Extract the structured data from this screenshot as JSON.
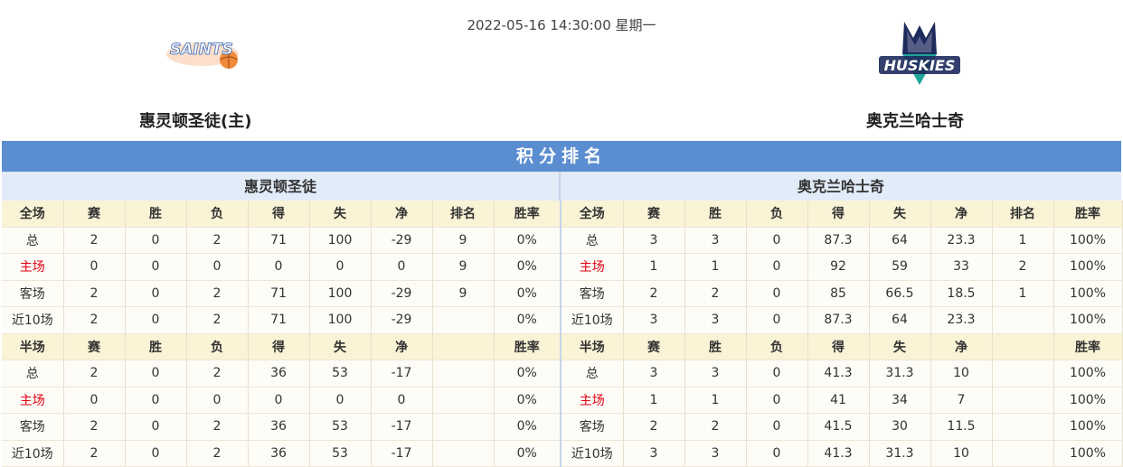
{
  "match": {
    "datetime": "2022-05-16 14:30:00 星期一",
    "home_team": "惠灵顿圣徒(主)",
    "away_team": "奥克兰哈士奇",
    "home_logo_text": "SAINTS",
    "away_logo_text": "HUSKIES"
  },
  "standings": {
    "title": "积分排名",
    "home_label": "惠灵顿圣徒",
    "away_label": "奥克兰哈士奇",
    "full_header": [
      "全场",
      "赛",
      "胜",
      "负",
      "得",
      "失",
      "净",
      "排名",
      "胜率"
    ],
    "half_header": [
      "半场",
      "赛",
      "胜",
      "负",
      "得",
      "失",
      "净",
      "",
      "胜率"
    ],
    "home_full": [
      [
        "总",
        "2",
        "0",
        "2",
        "71",
        "100",
        "-29",
        "9",
        "0%"
      ],
      [
        "主场",
        "0",
        "0",
        "0",
        "0",
        "0",
        "0",
        "9",
        "0%"
      ],
      [
        "客场",
        "2",
        "0",
        "2",
        "71",
        "100",
        "-29",
        "9",
        "0%"
      ],
      [
        "近10场",
        "2",
        "0",
        "2",
        "71",
        "100",
        "-29",
        "",
        "0%"
      ]
    ],
    "home_half": [
      [
        "总",
        "2",
        "0",
        "2",
        "36",
        "53",
        "-17",
        "",
        "0%"
      ],
      [
        "主场",
        "0",
        "0",
        "0",
        "0",
        "0",
        "0",
        "",
        "0%"
      ],
      [
        "客场",
        "2",
        "0",
        "2",
        "36",
        "53",
        "-17",
        "",
        "0%"
      ],
      [
        "近10场",
        "2",
        "0",
        "2",
        "36",
        "53",
        "-17",
        "",
        "0%"
      ]
    ],
    "away_full": [
      [
        "总",
        "3",
        "3",
        "0",
        "87.3",
        "64",
        "23.3",
        "1",
        "100%"
      ],
      [
        "主场",
        "1",
        "1",
        "0",
        "92",
        "59",
        "33",
        "2",
        "100%"
      ],
      [
        "客场",
        "2",
        "2",
        "0",
        "85",
        "66.5",
        "18.5",
        "1",
        "100%"
      ],
      [
        "近10场",
        "3",
        "3",
        "0",
        "87.3",
        "64",
        "23.3",
        "",
        "100%"
      ]
    ],
    "away_half": [
      [
        "总",
        "3",
        "3",
        "0",
        "41.3",
        "31.3",
        "10",
        "",
        "100%"
      ],
      [
        "主场",
        "1",
        "1",
        "0",
        "41",
        "34",
        "7",
        "",
        "100%"
      ],
      [
        "客场",
        "2",
        "2",
        "0",
        "41.5",
        "30",
        "11.5",
        "",
        "100%"
      ],
      [
        "近10场",
        "3",
        "3",
        "0",
        "41.3",
        "31.3",
        "10",
        "",
        "100%"
      ]
    ]
  },
  "colors": {
    "title_bar": "#5b8dd1",
    "sub_header": "#e2ecf9",
    "table_header": "#fbf3d6",
    "home_row_label": "#e60012",
    "saints_orange": "#f08a3c",
    "huskies_navy": "#1d2a5c",
    "huskies_teal": "#1fa59a"
  }
}
